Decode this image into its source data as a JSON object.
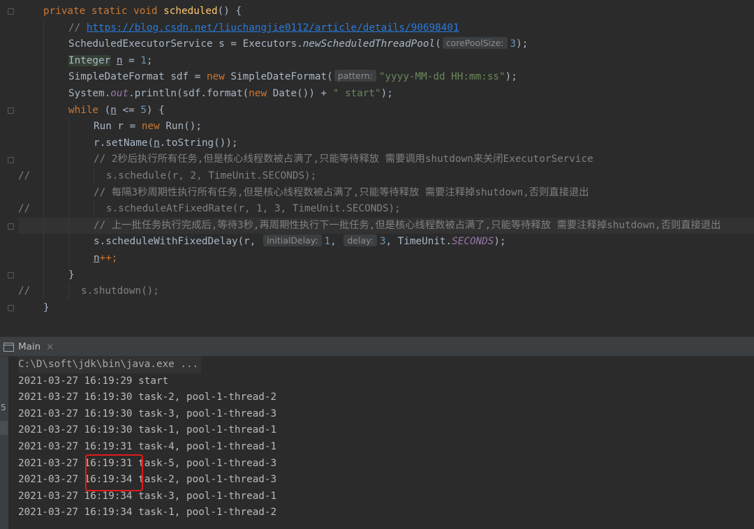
{
  "editor": {
    "lines": [
      [
        [
          "kw",
          "private static void "
        ],
        [
          "fn",
          "scheduled"
        ],
        [
          "p",
          "() {"
        ]
      ],
      [
        [
          "cm",
          "// "
        ],
        [
          "ln",
          "https://blog.csdn.net/liuchangjie0112/article/details/90698401"
        ]
      ],
      [
        [
          "p",
          "ScheduledExecutorService s = Executors."
        ],
        [
          "itp",
          "newScheduledThreadPool"
        ],
        [
          "p",
          "("
        ],
        [
          "hint",
          "corePoolSize:"
        ],
        [
          "num",
          "3"
        ],
        [
          "p",
          ");"
        ]
      ],
      [
        [
          "typehl",
          "Integer"
        ],
        [
          "p",
          " "
        ],
        [
          "ul",
          "n"
        ],
        [
          "p",
          " = "
        ],
        [
          "num",
          "1"
        ],
        [
          "p",
          ";"
        ]
      ],
      [
        [
          "p",
          "SimpleDateFormat sdf = "
        ],
        [
          "kw",
          "new "
        ],
        [
          "p",
          "SimpleDateFormat("
        ],
        [
          "hint",
          "pattern:"
        ],
        [
          "str",
          "\"yyyy-MM-dd HH:mm:ss\""
        ],
        [
          "p",
          ");"
        ]
      ],
      [
        [
          "p",
          "System."
        ],
        [
          "it",
          "out"
        ],
        [
          "p",
          ".println(sdf.format("
        ],
        [
          "kw",
          "new "
        ],
        [
          "p",
          "Date()) + "
        ],
        [
          "str",
          "\" start\""
        ],
        [
          "p",
          ");"
        ]
      ],
      [
        [
          "kw",
          "while "
        ],
        [
          "p",
          "("
        ],
        [
          "ul",
          "n"
        ],
        [
          "p",
          " <= "
        ],
        [
          "num",
          "5"
        ],
        [
          "p",
          ") {"
        ]
      ],
      [
        [
          "p",
          "Run r = "
        ],
        [
          "kw",
          "new "
        ],
        [
          "p",
          "Run();"
        ]
      ],
      [
        [
          "p",
          "r.setName("
        ],
        [
          "ul",
          "n"
        ],
        [
          "p",
          ".toString());"
        ]
      ],
      [
        [
          "cm",
          "// 2秒后执行所有任务,但是核心线程数被占满了,只能等待释放 需要调用shutdown来关闭ExecutorService"
        ]
      ],
      [
        [
          "cm",
          "s.schedule(r, 2, TimeUnit.SECONDS);"
        ]
      ],
      [
        [
          "cm",
          "// 每隔3秒周期性执行所有任务,但是核心线程数被占满了,只能等待释放 需要注释掉shutdown,否则直接退出"
        ]
      ],
      [
        [
          "cm",
          "s.scheduleAtFixedRate(r, 1, 3, TimeUnit.SECONDS);"
        ]
      ],
      [
        [
          "cm",
          "// 上一批任务执行完成后,等待3秒,再周期性执行下一批任务,但是核心线程数被占满了,只能等待释放 需要注释掉shutdown,否则直接退出"
        ]
      ],
      [
        [
          "p",
          "s.scheduleWithFixedDelay(r, "
        ],
        [
          "hint",
          "initialDelay:"
        ],
        [
          "num",
          "1"
        ],
        [
          "p",
          ", "
        ],
        [
          "hint",
          "delay:"
        ],
        [
          "num",
          "3"
        ],
        [
          "p",
          ", TimeUnit."
        ],
        [
          "it",
          "SECONDS"
        ],
        [
          "p",
          ");"
        ]
      ],
      [
        [
          "ul",
          "n"
        ],
        [
          "kw",
          "++"
        ],
        [
          "kw",
          ";"
        ]
      ],
      [
        [
          "p",
          "}"
        ]
      ],
      [
        [
          "cm",
          "s.shutdown();"
        ]
      ],
      [
        [
          "p",
          "}"
        ]
      ]
    ],
    "comment_prefix": "//"
  },
  "run_panel": {
    "tab_label": "Main",
    "tab_close": "×",
    "console_lines": [
      "C:\\D\\soft\\jdk\\bin\\java.exe ...",
      "2021-03-27 16:19:29 start",
      "2021-03-27 16:19:30 task-2, pool-1-thread-2",
      "2021-03-27 16:19:30 task-3, pool-1-thread-3",
      "2021-03-27 16:19:30 task-1, pool-1-thread-1",
      "2021-03-27 16:19:31 task-4, pool-1-thread-1",
      "2021-03-27 16:19:31 task-5, pool-1-thread-3",
      "2021-03-27 16:19:34 task-2, pool-1-thread-3",
      "2021-03-27 16:19:34 task-3, pool-1-thread-1",
      "2021-03-27 16:19:34 task-1, pool-1-thread-2"
    ]
  },
  "colors": {
    "keyword": "#cc7832",
    "method": "#ffc66d",
    "comment": "#808080",
    "string": "#6a8759",
    "number": "#6897bb",
    "highlight_box": "#e01b1b"
  }
}
